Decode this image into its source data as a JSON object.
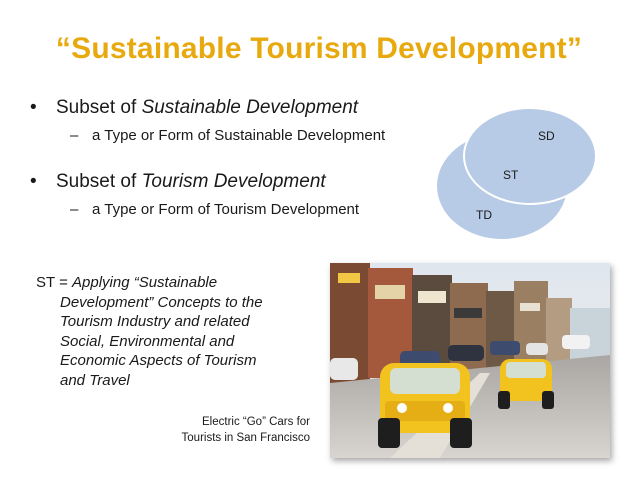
{
  "slide": {
    "title": "“Sustainable Tourism Development”",
    "bullets": [
      {
        "prefix": "Subset of ",
        "emphasis": "Sustainable Development",
        "sub": "a Type or Form of Sustainable Development"
      },
      {
        "prefix": "Subset of ",
        "emphasis": "Tourism Development",
        "sub": "a Type or Form of Tourism Development"
      }
    ],
    "venn": {
      "outer_label": "SD",
      "overlap_label": "ST",
      "inner_label": "TD",
      "fill": "#b7cbe6",
      "stroke": "#ffffff"
    },
    "definition": {
      "prefix": "ST = ",
      "lines": [
        "Applying “Sustainable",
        "Development” Concepts to the",
        "Tourism Industry and related",
        "Social, Environmental and",
        "Economic Aspects of Tourism",
        "and Travel"
      ]
    },
    "caption": {
      "line1": "Electric “Go” Cars for",
      "line2": "Tourists in San Francisco"
    },
    "colors": {
      "title": "#e8a90f",
      "text": "#1a1a1a"
    }
  }
}
